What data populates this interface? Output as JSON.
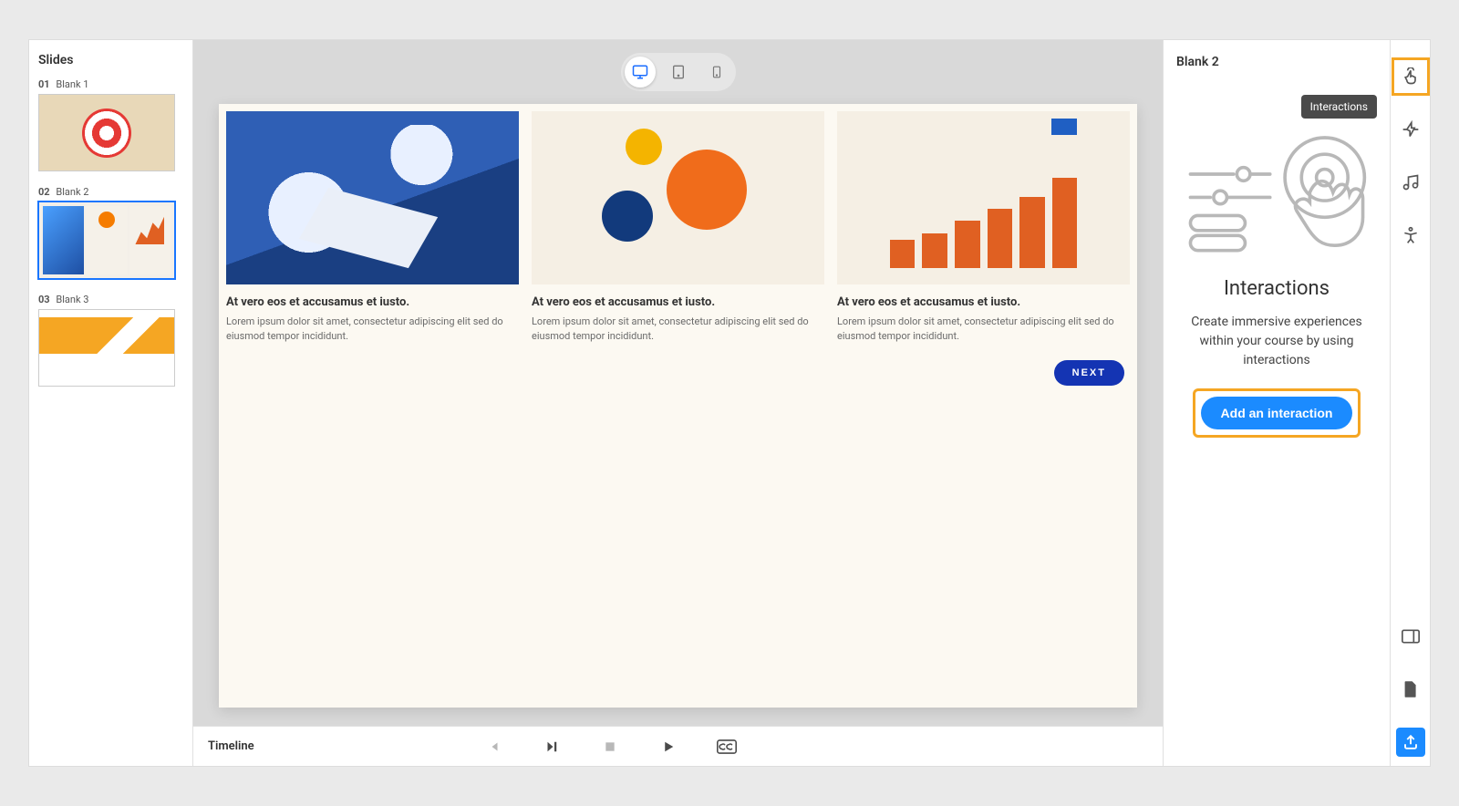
{
  "slides_panel": {
    "title": "Slides",
    "items": [
      {
        "num": "01",
        "name": "Blank 1"
      },
      {
        "num": "02",
        "name": "Blank 2"
      },
      {
        "num": "03",
        "name": "Blank 3"
      }
    ],
    "selected_index": 1
  },
  "device_toggle": {
    "options": [
      "desktop",
      "tablet",
      "mobile"
    ],
    "active": "desktop"
  },
  "slide_content": {
    "cards": [
      {
        "title": "At vero eos et accusamus et iusto.",
        "body": "Lorem ipsum dolor sit amet, consectetur adipiscing elit sed do eiusmod tempor incididunt."
      },
      {
        "title": "At vero eos et accusamus et iusto.",
        "body": "Lorem ipsum dolor sit amet, consectetur adipiscing elit sed do eiusmod tempor incididunt."
      },
      {
        "title": "At vero eos et accusamus et iusto.",
        "body": "Lorem ipsum dolor sit amet, consectetur adipiscing elit sed do eiusmod tempor incididunt."
      }
    ],
    "next_label": "NEXT"
  },
  "right_panel": {
    "slide_name": "Blank 2",
    "tooltip": "Interactions",
    "heading": "Interactions",
    "description": "Create immersive experiences within your course by using interactions",
    "add_button": "Add an interaction"
  },
  "tool_rail": {
    "items": [
      "interactions",
      "triggers",
      "audio",
      "accessibility"
    ],
    "bottom": [
      "panel-toggle",
      "document"
    ],
    "share": "share"
  },
  "timeline": {
    "title": "Timeline",
    "controls": [
      "step-back",
      "play-pause",
      "stop",
      "play",
      "cc"
    ]
  },
  "colors": {
    "accent_blue": "#1b8bff",
    "deep_blue": "#1434b3",
    "highlight_orange": "#f5a623"
  }
}
